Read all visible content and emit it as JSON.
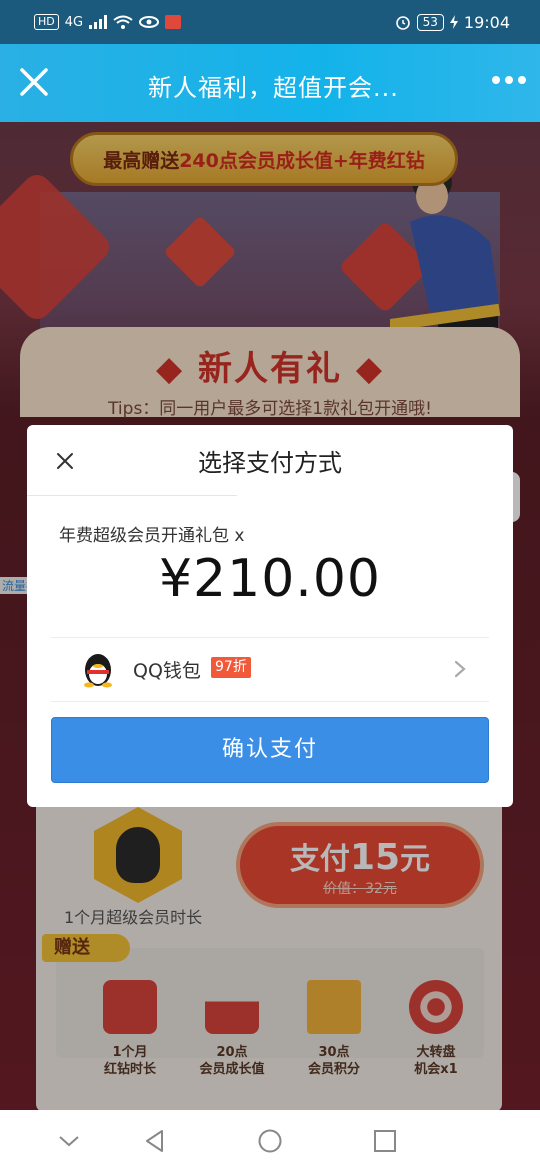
{
  "status_bar": {
    "hd": "HD",
    "net": "4G",
    "battery": "53",
    "time": "19:04"
  },
  "title_bar": {
    "title": "新人福利，超值开会..."
  },
  "promo": {
    "top_banner_prefix": "最高赠送",
    "top_banner_highlight": "240点会员成长值+年费红钻",
    "heading": "◆ 新人有礼 ◆",
    "tips": "Tips：同一用户最多可选择1款礼包开通哦!",
    "side_tag": "流量社区",
    "month_label": "1个月超级会员时长",
    "pay_prefix": "支付",
    "pay_amount": "15",
    "pay_suffix": "元",
    "original_price": "价值：32元",
    "gift_tag": "赠送",
    "gifts": [
      {
        "label": "1个月\n红钻时长"
      },
      {
        "label": "20点\n会员成长值"
      },
      {
        "label": "30点\n会员积分"
      },
      {
        "label": "大转盘\n机会x1"
      }
    ]
  },
  "dialog": {
    "title": "选择支付方式",
    "product": "年费超级会员开通礼包 x",
    "price": "¥210.00",
    "method_name": "QQ钱包",
    "method_discount": "97折",
    "confirm_label": "确认支付"
  },
  "colors": {
    "accent": "#3b8ee6",
    "title_bar": "#13b3ea",
    "discount": "#f05a3a"
  }
}
